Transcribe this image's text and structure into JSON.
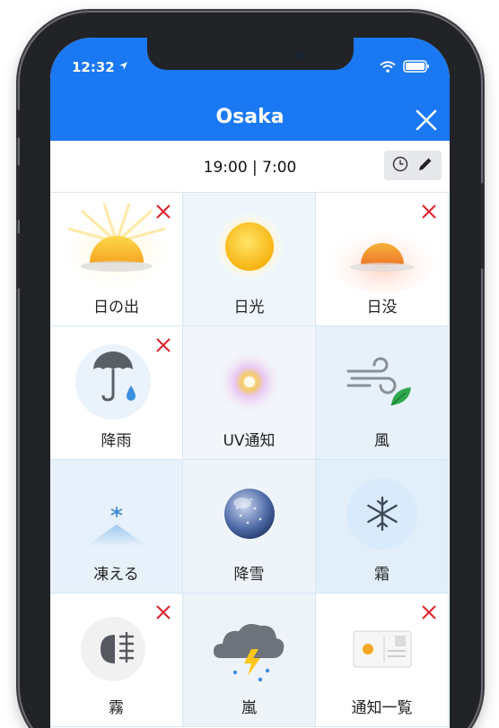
{
  "status": {
    "time": "12:32",
    "location_icon": "location-arrow-icon",
    "wifi_icon": "wifi-icon",
    "battery_icon": "battery-icon"
  },
  "header": {
    "title": "Osaka",
    "close_icon": "close-icon",
    "background": "#1a78f2"
  },
  "timebar": {
    "text": "19:00 | 7:00",
    "clock_icon": "clock-icon",
    "edit_icon": "pencil-icon"
  },
  "tiles": [
    {
      "label": "日の出",
      "icon": "sunrise-icon",
      "removable": true
    },
    {
      "label": "日光",
      "icon": "sun-icon",
      "removable": false
    },
    {
      "label": "日没",
      "icon": "sunset-icon",
      "removable": true
    },
    {
      "label": "降雨",
      "icon": "umbrella-icon",
      "removable": true
    },
    {
      "label": "UV通知",
      "icon": "uv-icon",
      "removable": false
    },
    {
      "label": "風",
      "icon": "wind-icon",
      "removable": false
    },
    {
      "label": "凍える",
      "icon": "freeze-icon",
      "removable": false
    },
    {
      "label": "降雪",
      "icon": "snow-globe-icon",
      "removable": false
    },
    {
      "label": "霜",
      "icon": "snowflake-icon",
      "removable": false
    },
    {
      "label": "霧",
      "icon": "fog-light-icon",
      "removable": true
    },
    {
      "label": "嵐",
      "icon": "storm-icon",
      "removable": false
    },
    {
      "label": "通知一覧",
      "icon": "postcard-icon",
      "removable": true
    }
  ],
  "colors": {
    "remove": "#e0202a",
    "tile_border": "#d5e6f3"
  }
}
